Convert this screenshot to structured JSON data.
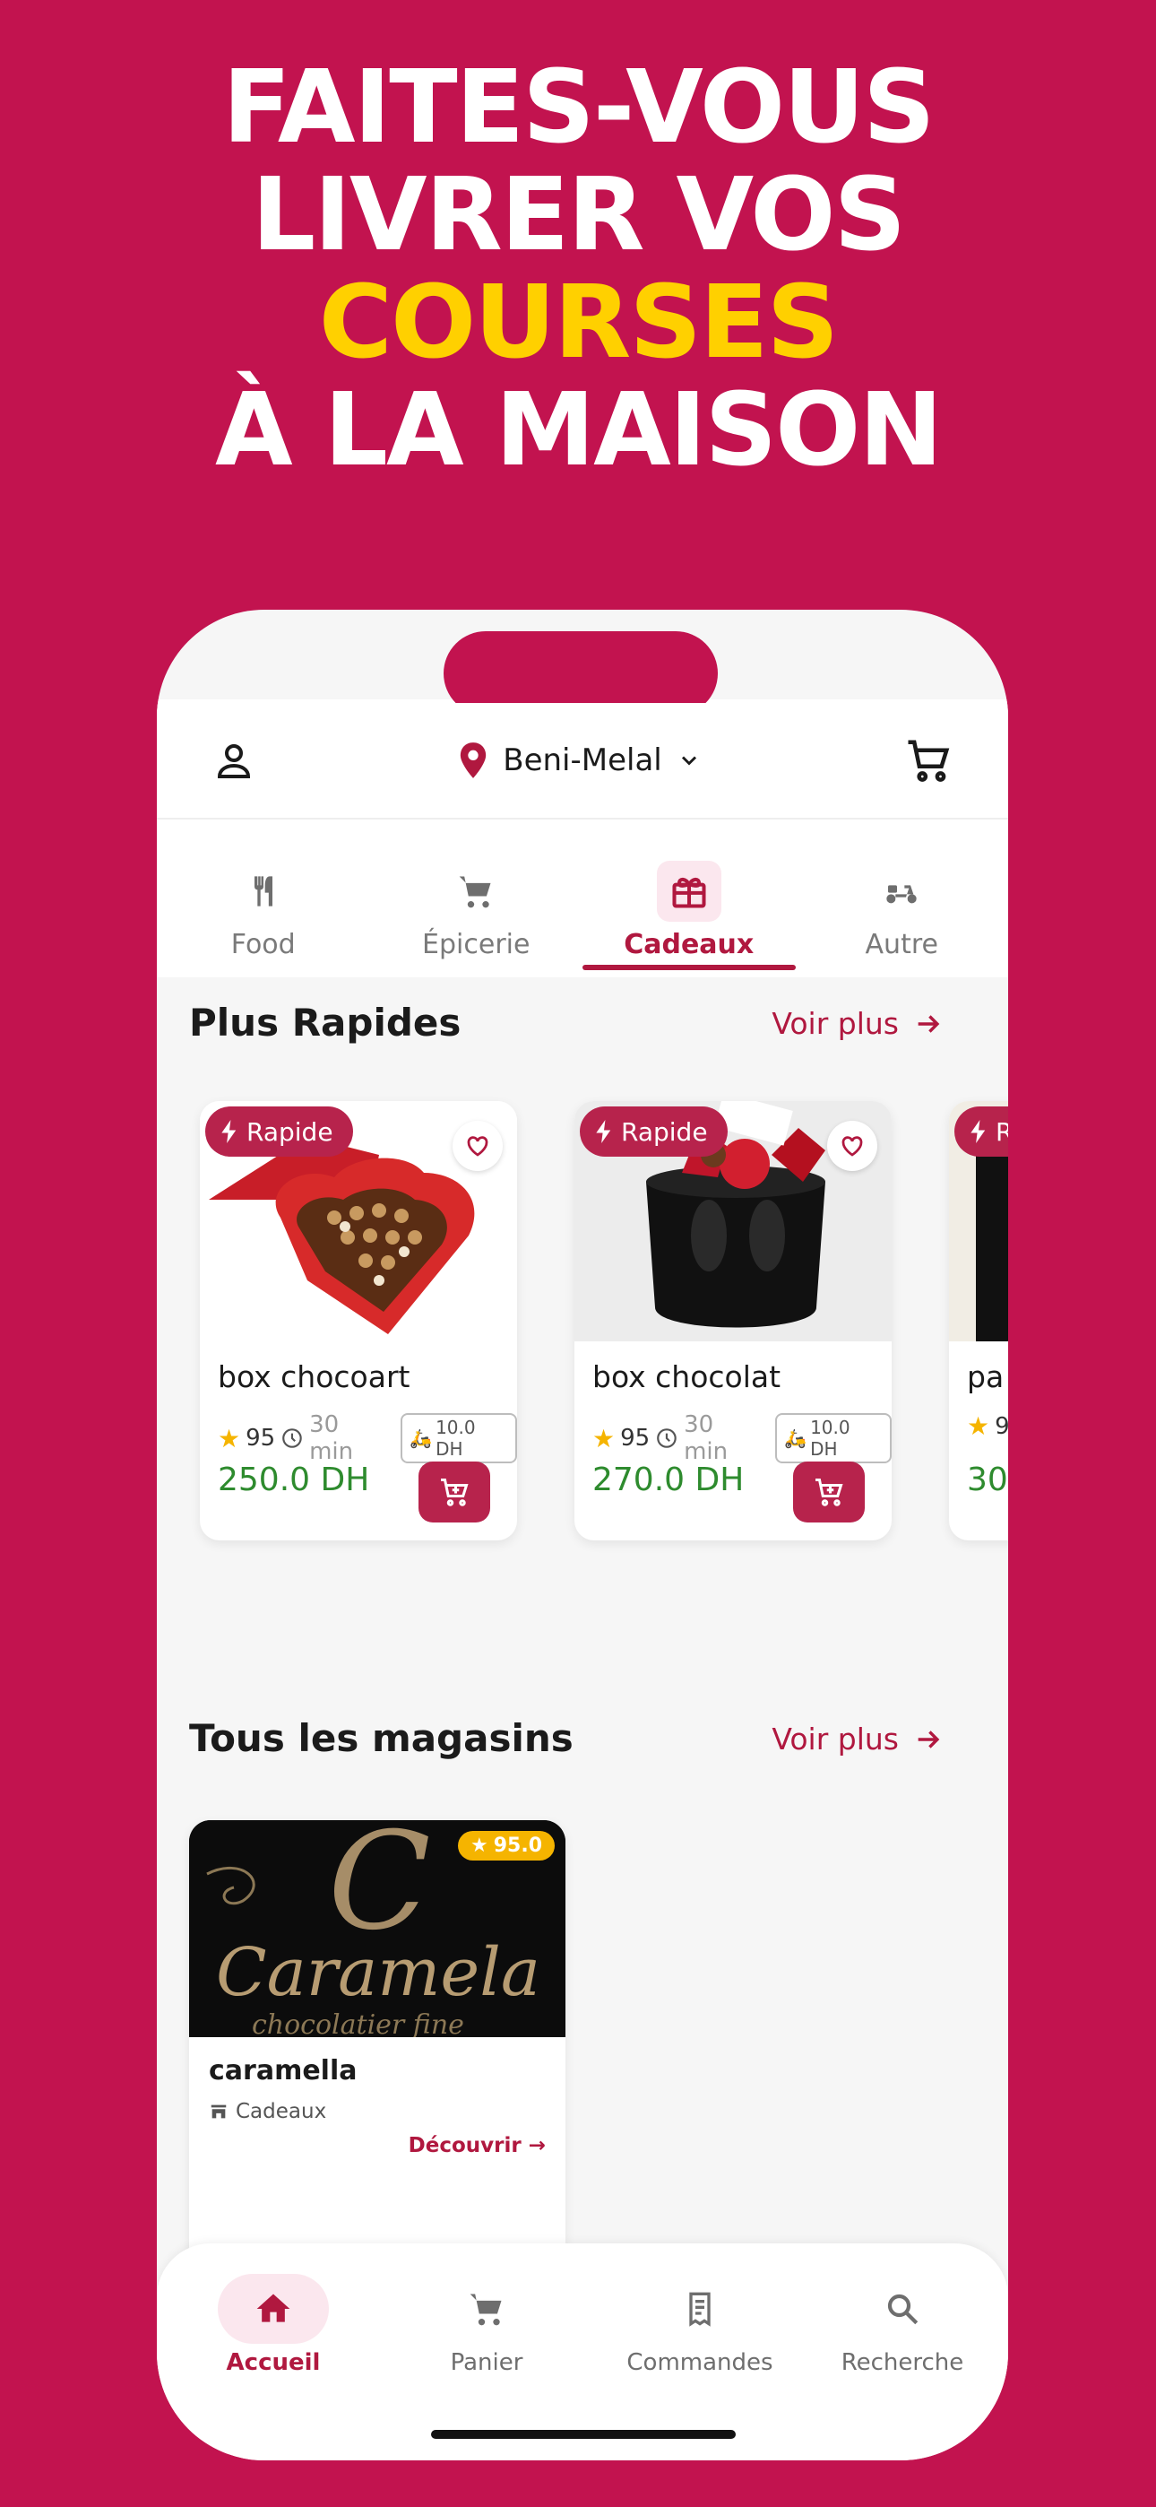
{
  "headline": {
    "line1": "FAITES-VOUS",
    "line2": "LIVRER VOS",
    "line3": "COURSES",
    "line4": "À LA MAISON"
  },
  "appbar": {
    "location": "Beni-Melal",
    "profile_icon": "user-icon",
    "location_icon": "map-pin-icon",
    "cart_icon": "cart-icon"
  },
  "categories": [
    {
      "label": "Food",
      "icon": "fork-knife-icon"
    },
    {
      "label": "Épicerie",
      "icon": "cart-icon"
    },
    {
      "label": "Cadeaux",
      "icon": "gift-icon",
      "active": true
    },
    {
      "label": "Autre",
      "icon": "scooter-icon"
    }
  ],
  "fast": {
    "title": "Plus Rapides",
    "see_more": "Voir plus",
    "products": [
      {
        "badge": "Rapide",
        "name": "box chocoart",
        "rating": "95",
        "time": "30 min",
        "delivery": "10.0 DH",
        "price": "250.0 DH"
      },
      {
        "badge": "Rapide",
        "name": "box chocolat",
        "rating": "95",
        "time": "30 min",
        "delivery": "10.0 DH",
        "price": "270.0 DH"
      },
      {
        "badge": "R",
        "name": "pa",
        "rating": "9",
        "price": "30"
      }
    ]
  },
  "stores": {
    "title": "Tous les magasins",
    "see_more": "Voir plus",
    "items": [
      {
        "name": "caramella",
        "rating": "95.0",
        "type": "Cadeaux",
        "cta": "Découvrir →",
        "logo_text": "Caramela",
        "logo_sub": "chocolatier fine"
      }
    ]
  },
  "bottom_nav": [
    {
      "label": "Accueil",
      "icon": "home-icon",
      "active": true
    },
    {
      "label": "Panier",
      "icon": "cart-icon"
    },
    {
      "label": "Commandes",
      "icon": "receipt-icon"
    },
    {
      "label": "Recherche",
      "icon": "search-icon"
    }
  ],
  "colors": {
    "background": "#c2134f",
    "accent": "#b0183f",
    "yellow": "#ffd000",
    "price_green": "#2e8b2e"
  }
}
